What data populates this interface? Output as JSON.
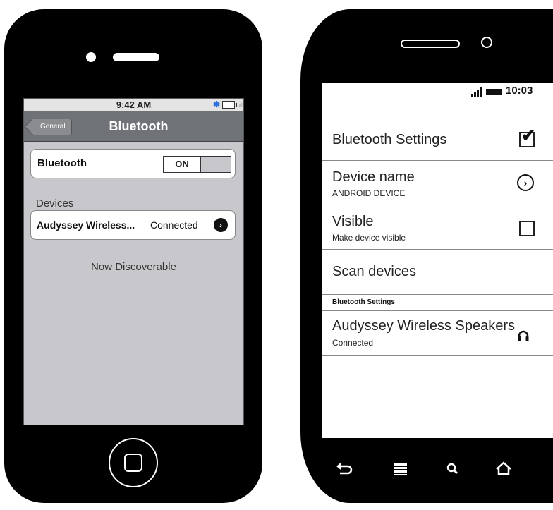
{
  "ios": {
    "status_time": "9:42 AM",
    "back_label": "General",
    "title": "Bluetooth",
    "bluetooth_label": "Bluetooth",
    "toggle_state": "ON",
    "section_devices": "Devices",
    "device_name": "Audyssey Wireless...",
    "device_status": "Connected",
    "discoverable": "Now Discoverable"
  },
  "android": {
    "status_time": "10:03",
    "rows": {
      "bluetooth_settings": "Bluetooth Settings",
      "device_name_title": "Device name",
      "device_name_value": "ANDROID DEVICE",
      "visible_title": "Visible",
      "visible_sub": "Make device visible",
      "scan": "Scan devices",
      "section_header": "Bluetooth Settings",
      "speaker_name": "Audyssey Wireless Speakers",
      "speaker_status": "Connected"
    }
  },
  "icons": {
    "bluetooth": "bluetooth-icon",
    "battery": "battery-icon",
    "signal": "signal-icon",
    "chevron": "chevron-right-icon",
    "headphones": "headphones-icon",
    "back": "back-icon",
    "menu": "menu-icon",
    "search": "search-icon",
    "home": "home-icon"
  }
}
